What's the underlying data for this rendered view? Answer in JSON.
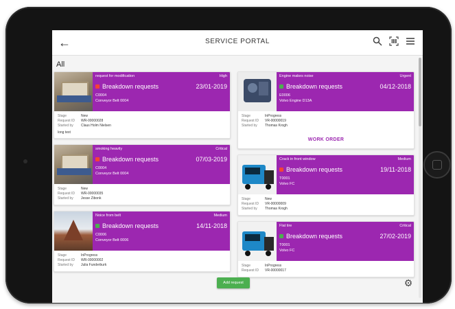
{
  "header": {
    "title": "SERVICE PORTAL",
    "back_icon": "arrow-left-icon",
    "search_icon": "search-icon",
    "scan_icon": "barcode-scan-icon",
    "menu_icon": "menu-icon"
  },
  "filter_label": "All",
  "colors": {
    "card_purple": "#9c27b0",
    "status_red": "#f44336",
    "status_green": "#4caf50",
    "action_green": "#4caf50"
  },
  "meta_keys": {
    "stage": "Stage",
    "request_id": "Request ID",
    "started_by": "Started by"
  },
  "left_cards": [
    {
      "subject": "request for modification",
      "priority": "High",
      "kind": "Breakdown requests",
      "status_color": "#f44336",
      "date": "23/01-2019",
      "code": "C0004",
      "asset": "Conveyor Belt 0004",
      "stage": "New",
      "request_id": "WR-00000028",
      "started_by": "Claus Holm Nielsen",
      "extra": "long text"
    },
    {
      "subject": "smoking heavily",
      "priority": "Critical",
      "kind": "Breakdown requests",
      "status_color": "#f44336",
      "date": "07/03-2019",
      "code": "C0004",
      "asset": "Conveyor Belt 0004",
      "stage": "New",
      "request_id": "WR-00000035",
      "started_by": "Jesse Zibonk",
      "extra": ""
    },
    {
      "subject": "Noice from belt",
      "priority": "Medium",
      "kind": "Breakdown requests",
      "status_color": "#4caf50",
      "date": "14/11-2018",
      "code": "C0006",
      "asset": "Conveyor Belt 0006",
      "stage": "InProgress",
      "request_id": "WR-00000002",
      "started_by": "Julia Funderburk",
      "extra": ""
    }
  ],
  "right_cards": [
    {
      "subject": "Engine makes noise",
      "priority": "Urgent",
      "kind": "Breakdown requests",
      "status_color": "#4caf50",
      "date": "04/12-2018",
      "code": "E0006",
      "asset": "Volvo Engine D13A",
      "stage": "InProgress",
      "request_id": "VR-00000019",
      "started_by": "Thomas Krogh",
      "action": "WORK ORDER"
    },
    {
      "subject": "Crack in front window",
      "priority": "Medium",
      "kind": "Breakdown requests",
      "status_color": "#f44336",
      "date": "19/11-2018",
      "code": "T0001",
      "asset": "Volvo FC",
      "stage": "New",
      "request_id": "VR-00000009",
      "started_by": "Thomas Krogh"
    },
    {
      "subject": "Flat tire",
      "priority": "Critical",
      "kind": "Breakdown requests",
      "status_color": "#4caf50",
      "date": "27/02-2019",
      "code": "T0001",
      "asset": "Volvo FC",
      "stage": "InProgress",
      "request_id": "VR-00000017",
      "started_by": ""
    }
  ],
  "add_button_label": "Add request",
  "settings_icon": "gear-icon"
}
